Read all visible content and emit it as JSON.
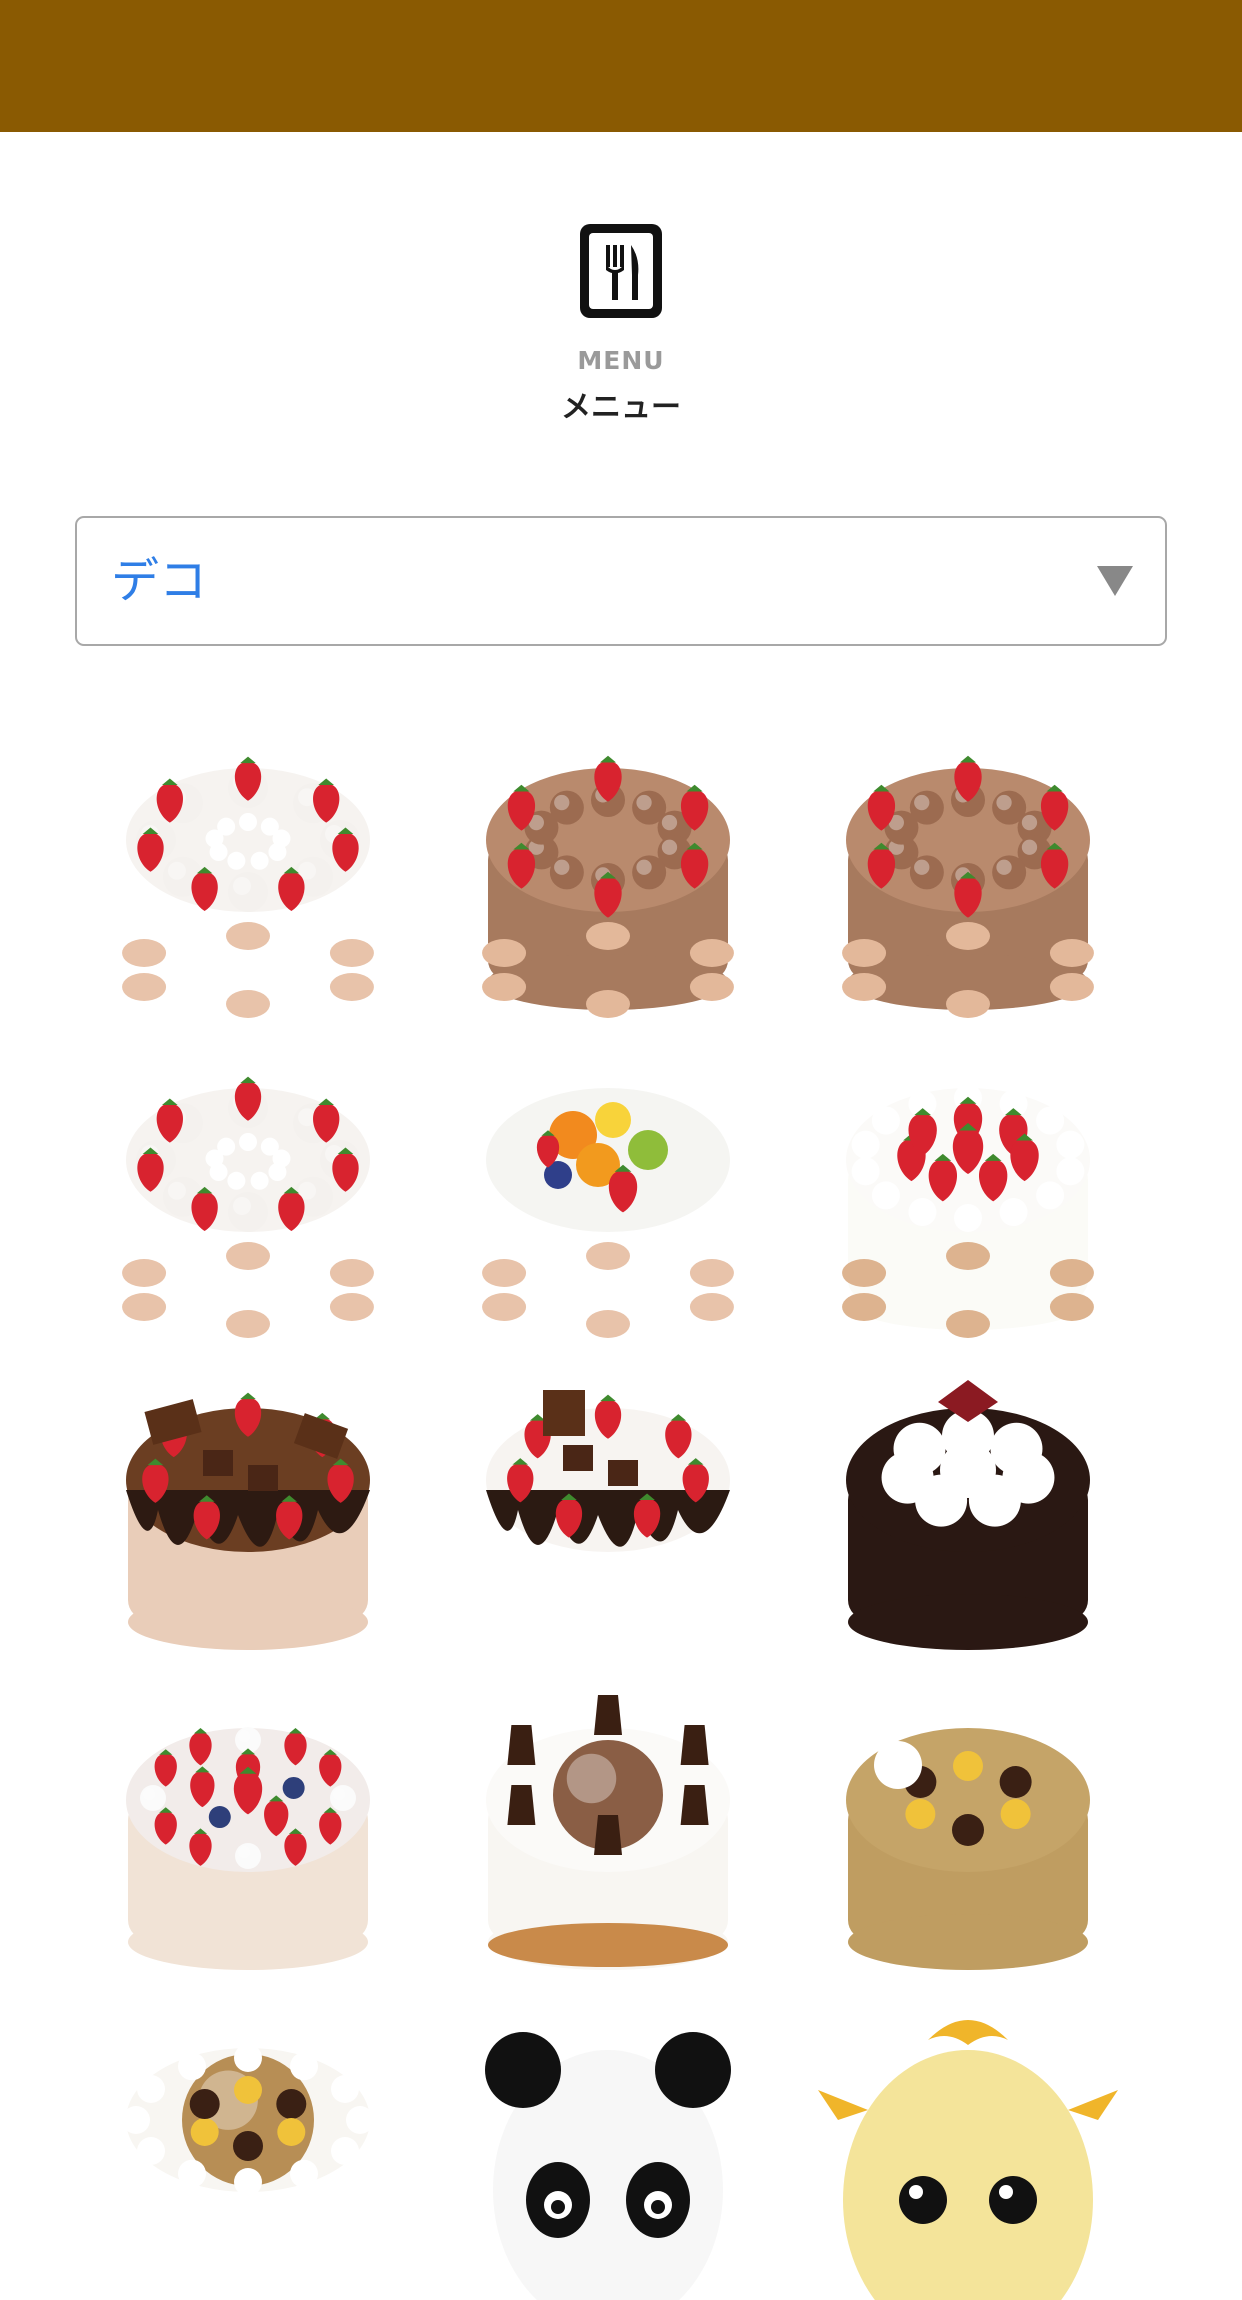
{
  "header": {
    "color": "#8a5a02"
  },
  "menu": {
    "icon": "fork-knife-icon",
    "title_en": "MENU",
    "title_ja": "メニュー"
  },
  "category_select": {
    "value": "デコ",
    "caret": "triangle-down-icon",
    "value_color": "#2f7ee6"
  },
  "products": [
    {
      "kind": "white-strawberry"
    },
    {
      "kind": "choco-strawberry"
    },
    {
      "kind": "choco-strawberry"
    },
    {
      "kind": "white-strawberry"
    },
    {
      "kind": "fruit"
    },
    {
      "kind": "strawberry-cream"
    },
    {
      "kind": "choco-drip-brown"
    },
    {
      "kind": "choco-drip-white"
    },
    {
      "kind": "dark-choco"
    },
    {
      "kind": "berry-tart"
    },
    {
      "kind": "tiramisu"
    },
    {
      "kind": "mont-blanc"
    },
    {
      "kind": "chestnut-ring"
    },
    {
      "kind": "panda"
    },
    {
      "kind": "chick"
    }
  ]
}
